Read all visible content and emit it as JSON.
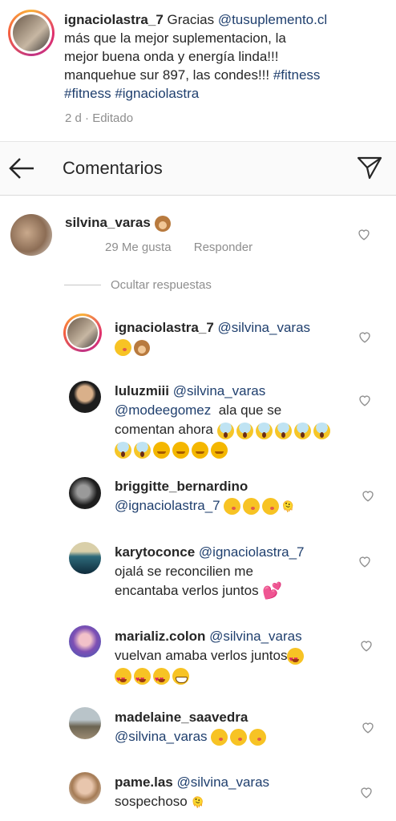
{
  "caption": {
    "username": "ignaciolastra_7",
    "text_pre": "Gracias ",
    "mention": "@tusuplemento.cl",
    "line2": "más que la mejor suplementacion, la",
    "line3": "mejor buena onda y energía linda!!!",
    "line4_pre": "manquehue sur 897, las condes!!! ",
    "line4_tag": "#fitness",
    "line5_tag1": "#fitness",
    "line5_tag2": "#ignaciolastra",
    "time": "2 d",
    "sep": "·",
    "edited": "Editado"
  },
  "header": {
    "title": "Comentarios",
    "back_icon": "arrow-left-icon",
    "share_icon": "paper-plane-icon"
  },
  "parent_comment": {
    "username": "silvina_varas",
    "likes": "29 Me gusta",
    "reply": "Responder"
  },
  "hide_replies": "Ocultar respuestas",
  "replies": [
    {
      "username": "ignaciolastra_7",
      "mention": "@silvina_varas"
    },
    {
      "username": "luluzmiii",
      "mention": "@silvina_varas",
      "mention2": "@modeegomez",
      "text": "ala que se",
      "text2": "comentan ahora"
    },
    {
      "username": "briggitte_bernardino",
      "mention": "@ignaciolastra_7",
      "glyph": "🫠"
    },
    {
      "username": "karytoconce",
      "mention": "@ignaciolastra_7",
      "text": "ojalá se reconcilien me",
      "text2": "encantaba verlos juntos"
    },
    {
      "username": "marializ.colon",
      "mention": "@silvina_varas",
      "text": "vuelvan amaba verlos juntos"
    },
    {
      "username": "madelaine_saavedra",
      "mention": "@silvina_varas"
    },
    {
      "username": "pame.las",
      "mention": "@silvina_varas",
      "text": "sospechoso",
      "glyph": "🫠"
    }
  ],
  "colors": {
    "mention": "#1f3f6e",
    "meta": "#8e8e8e",
    "header_bg": "#fafafa"
  }
}
